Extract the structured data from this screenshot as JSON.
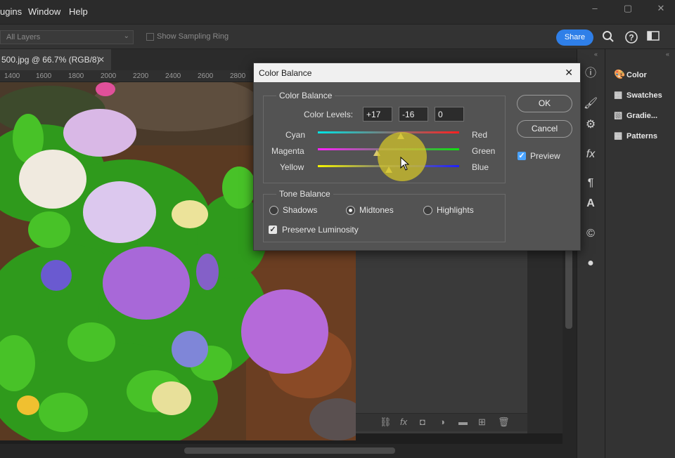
{
  "menubar": {
    "items": [
      "ugins",
      "Window",
      "Help"
    ]
  },
  "options": {
    "sample_select": "All Layers",
    "sampling_ring_label": "Show Sampling Ring",
    "share_label": "Share"
  },
  "document": {
    "tab_label": "500.jpg @ 66.7% (RGB/8)",
    "ruler_ticks": [
      "1400",
      "1600",
      "1800",
      "2000",
      "2200",
      "2400",
      "2600",
      "2800"
    ]
  },
  "panels": {
    "items": [
      {
        "label": "Color",
        "icon": "palette-icon"
      },
      {
        "label": "Swatches",
        "icon": "grid-icon"
      },
      {
        "label": "Gradie...",
        "icon": "gradient-icon"
      },
      {
        "label": "Patterns",
        "icon": "grid-icon"
      }
    ]
  },
  "dialog": {
    "title": "Color Balance",
    "color_balance_group": "Color Balance",
    "color_levels_label": "Color Levels:",
    "levels": [
      "+17",
      "-16",
      "0"
    ],
    "sliders": [
      {
        "left": "Cyan",
        "right": "Red",
        "value": 17,
        "left_color": "#00e5e5",
        "right_color": "#ff2020"
      },
      {
        "left": "Magenta",
        "right": "Green",
        "value": -16,
        "left_color": "#ff20ff",
        "right_color": "#10e010"
      },
      {
        "left": "Yellow",
        "right": "Blue",
        "value": 0,
        "left_color": "#f5f500",
        "right_color": "#2020ff"
      }
    ],
    "tone_balance_group": "Tone Balance",
    "tones": [
      "Shadows",
      "Midtones",
      "Highlights"
    ],
    "selected_tone": "Midtones",
    "preserve_luminosity": "Preserve Luminosity",
    "ok": "OK",
    "cancel": "Cancel",
    "preview": "Preview"
  }
}
